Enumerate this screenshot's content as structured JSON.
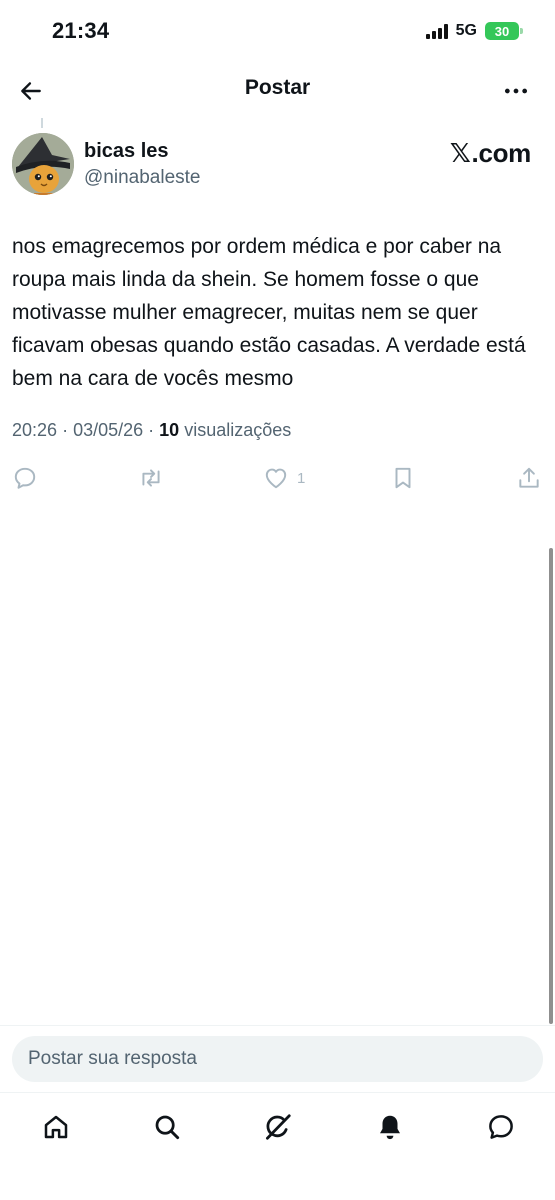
{
  "status_bar": {
    "time": "21:34",
    "network": "5G",
    "battery": "30"
  },
  "nav": {
    "title": "Postar"
  },
  "post": {
    "display_name": "bicas les",
    "handle": "@ninabaleste",
    "source_label": ".com",
    "text": "nos emagrecemos por ordem médica e por caber na roupa mais linda da shein. Se homem fosse o que motivasse mulher emagrecer, muitas nem se quer ficavam obesas quando estão casadas. A verdade está bem na cara de vocês mesmo",
    "time": "20:26",
    "date": "03/05/26",
    "views_count": "10",
    "views_label": "visualizações",
    "like_count": "1"
  },
  "reply": {
    "placeholder": "Postar sua resposta"
  },
  "icons": {
    "back": "back-arrow-icon",
    "more": "more-dots-icon",
    "reply": "reply-icon",
    "repost": "repost-icon",
    "like": "heart-icon",
    "bookmark": "bookmark-icon",
    "share": "share-icon",
    "home": "home-icon",
    "search": "search-icon",
    "grok": "grok-icon",
    "notifications": "bell-icon",
    "messages": "messages-icon"
  },
  "colors": {
    "text": "#0f1419",
    "secondary": "#536471",
    "action_icon": "#aab8c2",
    "battery": "#34c759"
  }
}
